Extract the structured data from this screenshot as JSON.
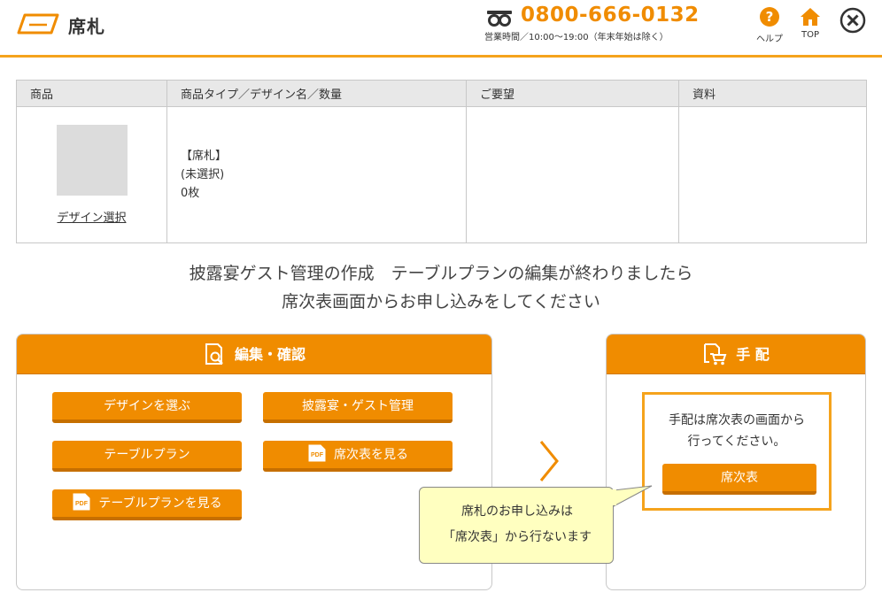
{
  "header": {
    "title": "席札",
    "phone_number": "0800-666-0132",
    "phone_hours": "営業時間／10:00〜19:00（年末年始は除く）",
    "help_label": "ヘルプ",
    "top_label": "TOP"
  },
  "product_table": {
    "headers": [
      "商品",
      "商品タイプ／デザイン名／数量",
      "ご要望",
      "資料"
    ],
    "design_link": "デザイン選択",
    "product_type": "【席札】",
    "design_name": "(未選択)",
    "quantity": "0枚"
  },
  "notice": {
    "line1": "披露宴ゲスト管理の作成　テーブルプランの編集が終わりましたら",
    "line2": "席次表画面からお申し込みをしてください"
  },
  "edit_panel": {
    "title": "編集・確認",
    "buttons": {
      "choose_design": "デザインを選ぶ",
      "guest_management": "披露宴・ゲスト管理",
      "table_plan": "テーブルプラン",
      "view_seating_chart": "席次表を見る",
      "view_table_plan": "テーブルプランを見る"
    }
  },
  "arrange_panel": {
    "title": "手 配",
    "message_line1": "手配は席次表の画面から",
    "message_line2": "行ってください。",
    "button": "席次表"
  },
  "tooltip": {
    "line1": "席札のお申し込みは",
    "line2": "「席次表」から行ないます"
  },
  "colors": {
    "accent": "#f08c00",
    "header_line": "#f5a31c",
    "tooltip_bg": "#ffffc0"
  },
  "icons": [
    "seat-card-logo-icon",
    "free-dial-icon",
    "help-icon",
    "home-icon",
    "close-icon",
    "document-search-icon",
    "cart-icon",
    "pdf-icon",
    "chevron-right-icon"
  ]
}
